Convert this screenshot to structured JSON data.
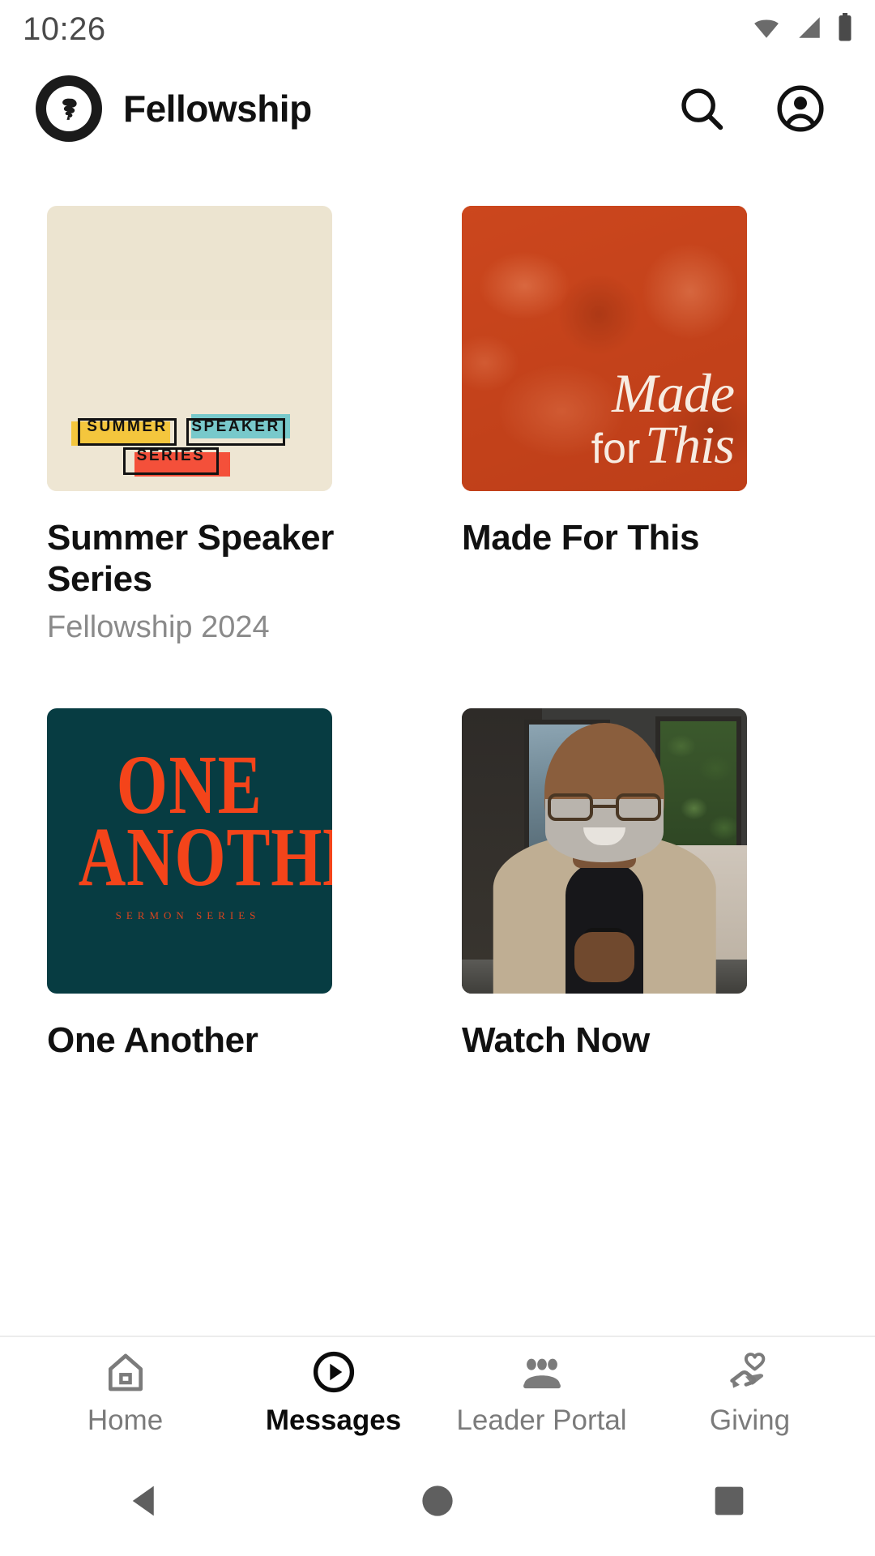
{
  "status_bar": {
    "time": "10:26",
    "icons": [
      "wifi-icon",
      "cellular-signal-icon",
      "battery-icon"
    ]
  },
  "header": {
    "logo_icon": "fellowship-logo-icon",
    "title": "Fellowship",
    "actions": [
      {
        "icon": "search-icon",
        "label": "Search"
      },
      {
        "icon": "account-circle-icon",
        "label": "Account"
      }
    ]
  },
  "colors": {
    "accent_orange": "#c8451f",
    "teal_dark": "#073c42",
    "orange_text": "#f4441a",
    "cream": "#ece4d0",
    "yellow_block": "#f4c63d",
    "teal_block": "#78c9cb",
    "red_block": "#f4503a",
    "muted_text": "#8a8a8a",
    "active_nav": "#0b0b0b",
    "inactive_nav": "#7b7b7b"
  },
  "cards": [
    {
      "id": "summer-speaker-series",
      "title": "Summer Speaker Series",
      "subtitle": "Fellowship 2024",
      "artwork": {
        "kind": "summer-speaker-series-artwork",
        "blocks": [
          {
            "text": "SUMMER",
            "color": "#f4c63d"
          },
          {
            "text": "SPEAKER",
            "color": "#78c9cb"
          },
          {
            "text": "SERIES",
            "color": "#f4503a"
          }
        ]
      }
    },
    {
      "id": "made-for-this",
      "title": "Made For This",
      "subtitle": "",
      "artwork": {
        "kind": "made-for-this-artwork",
        "script_line1": "Made",
        "script_word_for": "for",
        "script_line2": "This"
      }
    },
    {
      "id": "one-another",
      "title": "One Another",
      "subtitle": "",
      "artwork": {
        "kind": "one-another-artwork",
        "word1": "ONE",
        "word2": "ANOTHER",
        "tagline": "SERMON SERIES"
      }
    },
    {
      "id": "watch-now",
      "title": "Watch Now",
      "subtitle": "",
      "artwork": {
        "kind": "speaker-video-thumbnail"
      }
    }
  ],
  "bottom_nav": {
    "items": [
      {
        "label": "Home",
        "icon": "home-icon",
        "active": false
      },
      {
        "label": "Messages",
        "icon": "play-circle-icon",
        "active": true
      },
      {
        "label": "Leader Portal",
        "icon": "people-group-icon",
        "active": false
      },
      {
        "label": "Giving",
        "icon": "hand-heart-icon",
        "active": false
      }
    ]
  },
  "system_nav": {
    "back": "back-triangle-icon",
    "home": "home-circle-icon",
    "recents": "recents-square-icon"
  }
}
